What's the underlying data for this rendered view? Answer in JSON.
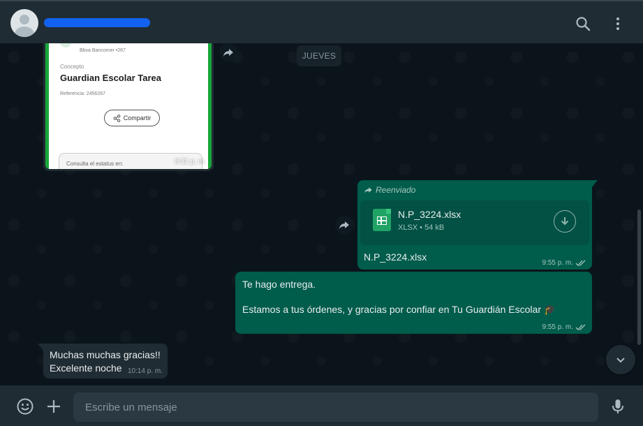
{
  "header": {
    "contact_name_redacted": true
  },
  "chat": {
    "date_separator": "JUEVES",
    "messages": [
      {
        "type": "image",
        "direction": "in",
        "receipt": {
          "bank": "Bbva Bancomer  •267",
          "concept_label": "Concepto",
          "concept": "Guardian Escolar Tarea",
          "reference": "Referencia: 2456267",
          "share_label": "Compartir",
          "status_label": "Consulta el estatus en:"
        },
        "time": "8:31 p. m."
      },
      {
        "type": "file",
        "direction": "out",
        "forwarded_label": "Reenviado",
        "file_name": "N.P_3224.xlsx",
        "file_meta": "XLSX • 54 kB",
        "caption": "N.P_3224.xlsx",
        "time": "9:55 p. m."
      },
      {
        "type": "text",
        "direction": "out",
        "line1": "Te hago entrega.",
        "line2": "Estamos a tus órdenes, y gracias por confiar en Tu Guardián Escolar 🎓",
        "time": "9:55 p. m."
      },
      {
        "type": "text",
        "direction": "in",
        "line1": "Muchas muchas gracias!!",
        "line2": "Excelente noche",
        "time": "10:14 p. m."
      }
    ]
  },
  "footer": {
    "placeholder": "Escribe un mensaje"
  },
  "colors": {
    "header_bg": "#202c33",
    "chat_bg": "#0b141a",
    "outgoing_bubble": "#005c4b",
    "incoming_bubble": "#202c33",
    "redaction": "#1361f0"
  }
}
